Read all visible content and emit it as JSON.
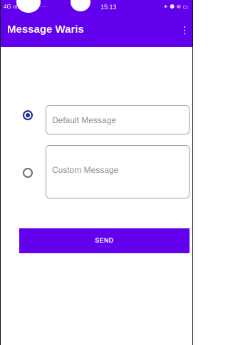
{
  "status_bar": {
    "left": "4G ıııl  G ııll  ⊠  ···",
    "time": "15:13",
    "right": "✶ ⚈ ≋ ▭"
  },
  "app_bar": {
    "title": "Message Waris",
    "menu_glyph": "⋮"
  },
  "form": {
    "options": [
      {
        "label": "Default Message",
        "selected": true
      },
      {
        "label": "Custom Message",
        "selected": false
      }
    ],
    "send_label": "SEND"
  },
  "colors": {
    "primary": "#6200ee",
    "radio_checked": "#1b2a9e"
  }
}
